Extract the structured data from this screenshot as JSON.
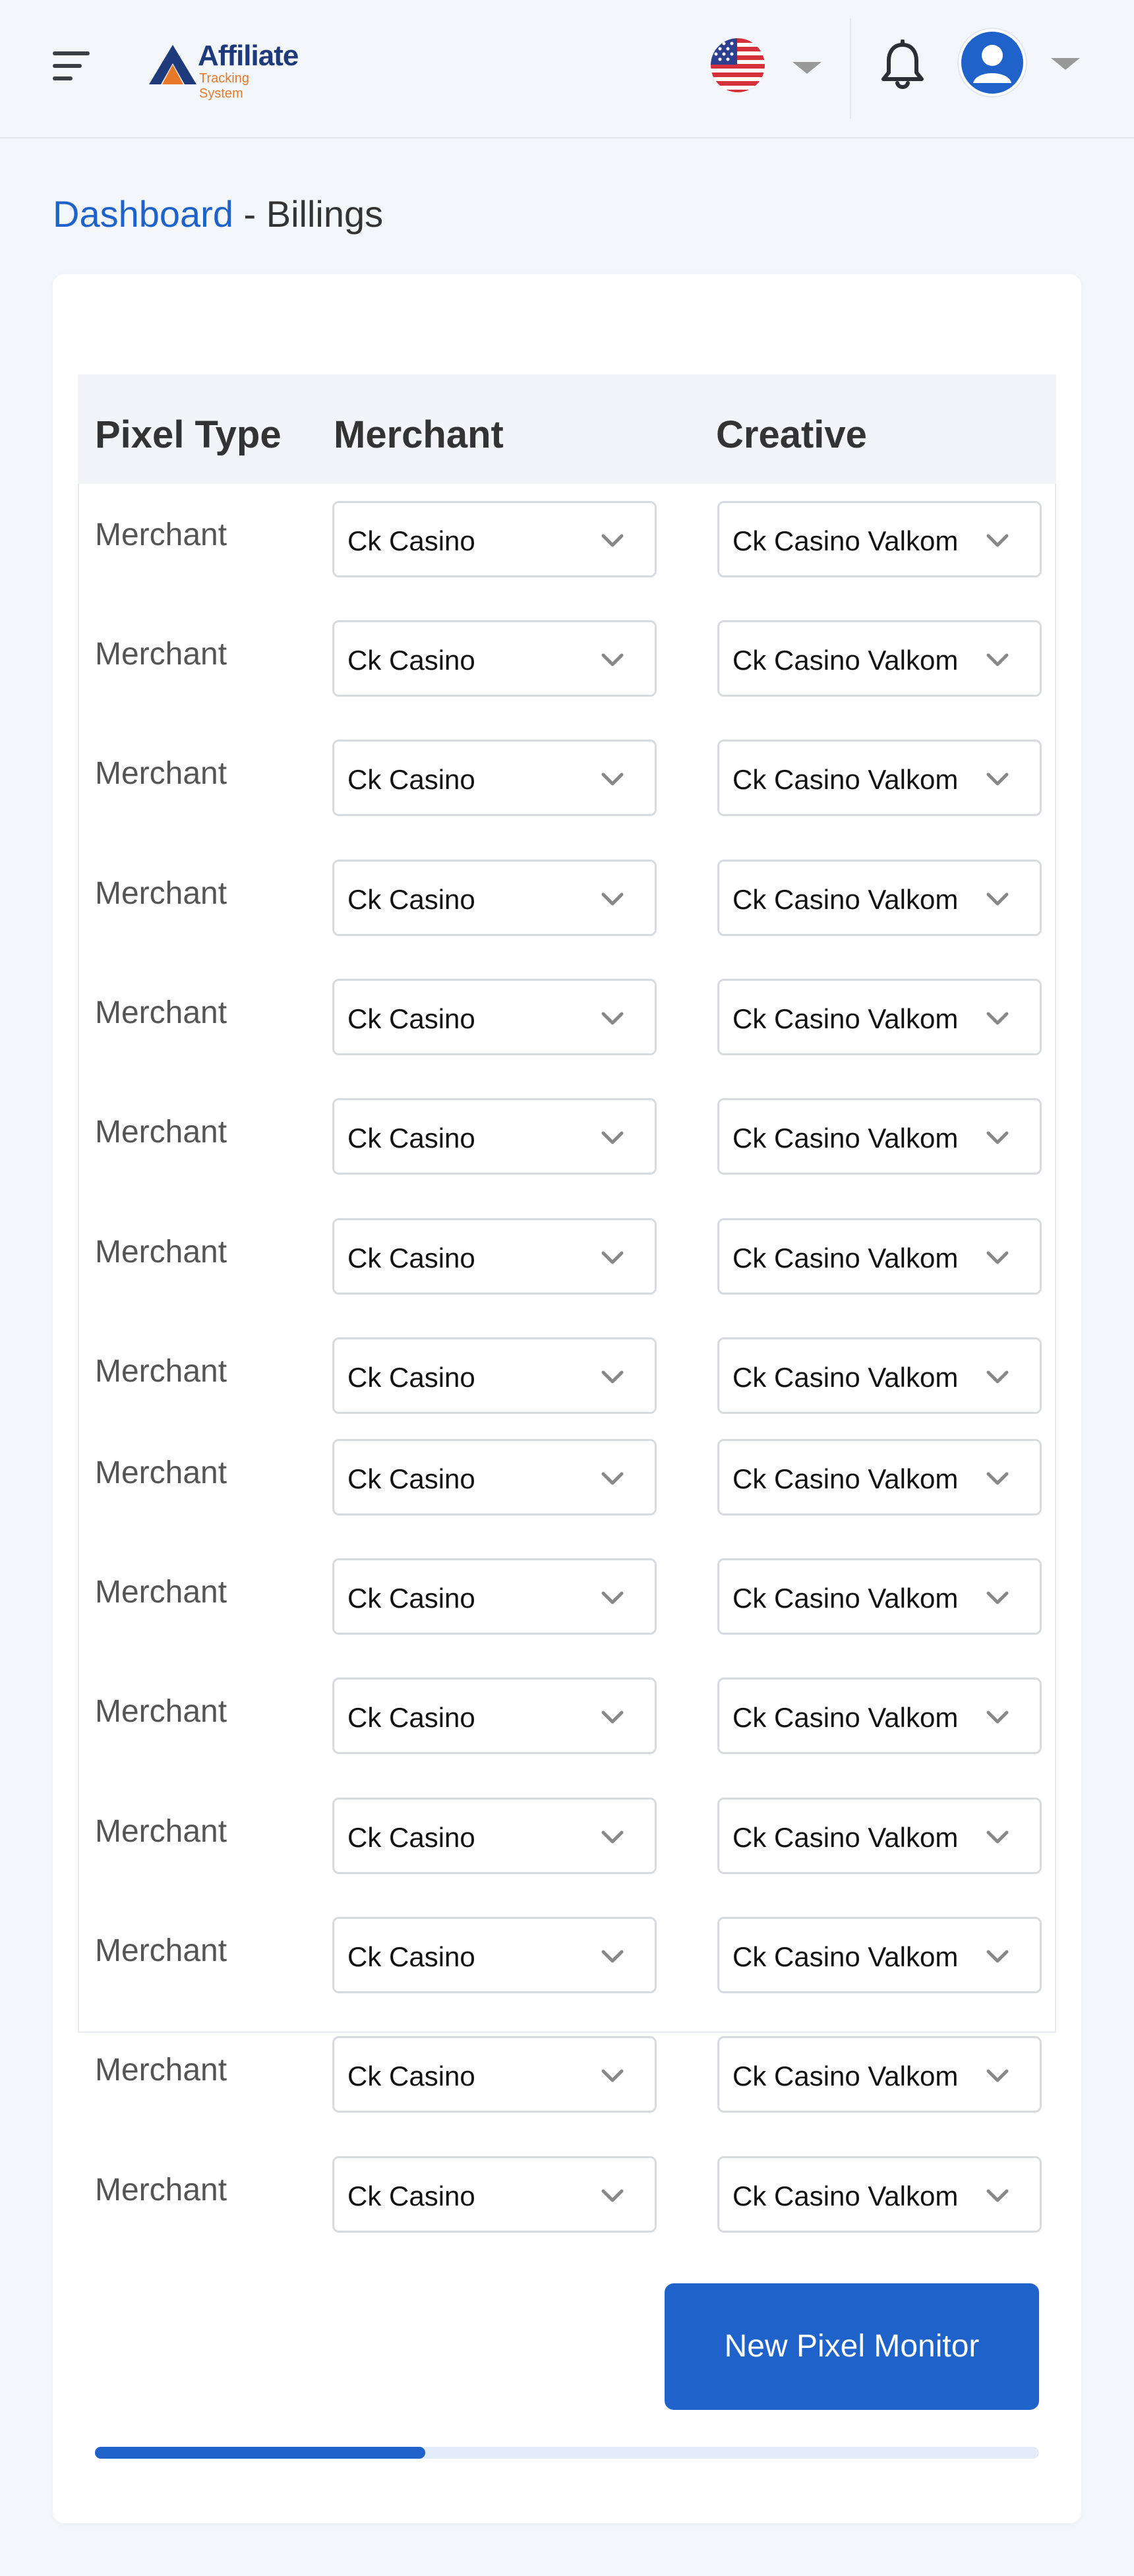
{
  "header": {
    "logo_brand": "Affiliate",
    "logo_sub": "Tracking System",
    "icons": {
      "menu": "hamburger-menu-icon",
      "language": "us-flag-icon",
      "notifications": "bell-icon",
      "user": "user-avatar-icon"
    }
  },
  "breadcrumb": {
    "link": "Dashboard",
    "separator": " - ",
    "current": "Billings"
  },
  "table": {
    "columns": [
      "Pixel Type",
      "Merchant",
      "Creative"
    ],
    "rows": [
      {
        "pixel_type": "Merchant",
        "merchant": "Ck Casino",
        "creative": "Ck Casino Valkom"
      },
      {
        "pixel_type": "Merchant",
        "merchant": "Ck Casino",
        "creative": "Ck Casino Valkom"
      },
      {
        "pixel_type": "Merchant",
        "merchant": "Ck Casino",
        "creative": "Ck Casino Valkom"
      },
      {
        "pixel_type": "Merchant",
        "merchant": "Ck Casino",
        "creative": "Ck Casino Valkom"
      },
      {
        "pixel_type": "Merchant",
        "merchant": "Ck Casino",
        "creative": "Ck Casino Valkom"
      },
      {
        "pixel_type": "Merchant",
        "merchant": "Ck Casino",
        "creative": "Ck Casino Valkom"
      },
      {
        "pixel_type": "Merchant",
        "merchant": "Ck Casino",
        "creative": "Ck Casino Valkom"
      },
      {
        "pixel_type": "Merchant",
        "merchant": "Ck Casino",
        "creative": "Ck Casino Valkom"
      },
      {
        "pixel_type": "Merchant",
        "merchant": "Ck Casino",
        "creative": "Ck Casino Valkom"
      },
      {
        "pixel_type": "Merchant",
        "merchant": "Ck Casino",
        "creative": "Ck Casino Valkom"
      },
      {
        "pixel_type": "Merchant",
        "merchant": "Ck Casino",
        "creative": "Ck Casino Valkom"
      },
      {
        "pixel_type": "Merchant",
        "merchant": "Ck Casino",
        "creative": "Ck Casino Valkom"
      },
      {
        "pixel_type": "Merchant",
        "merchant": "Ck Casino",
        "creative": "Ck Casino Valkom"
      },
      {
        "pixel_type": "Merchant",
        "merchant": "Ck Casino",
        "creative": "Ck Casino Valkom"
      },
      {
        "pixel_type": "Merchant",
        "merchant": "Ck Casino",
        "creative": "Ck Casino Valkom"
      }
    ]
  },
  "actions": {
    "new_pixel_monitor": "New Pixel Monitor"
  },
  "horizontal_scroll": {
    "thumb_fraction": 0.35
  },
  "colors": {
    "primary": "#1f62c9",
    "background": "#f4f7fa",
    "logo_orange": "#e8792a",
    "logo_navy": "#1e3a7a"
  }
}
